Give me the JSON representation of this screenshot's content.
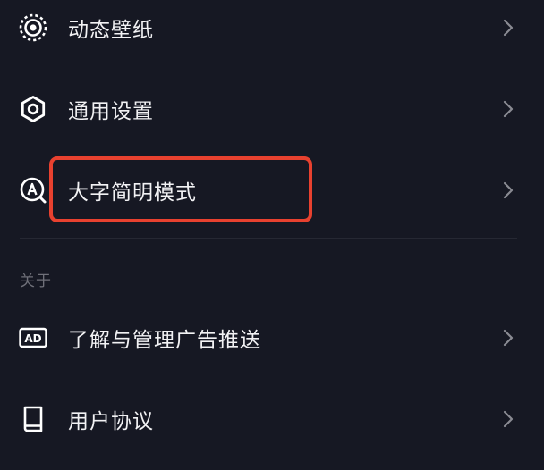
{
  "settings": {
    "items": [
      {
        "label": "动态壁纸",
        "icon": "live-wallpaper-icon"
      },
      {
        "label": "通用设置",
        "icon": "gear-icon"
      },
      {
        "label": "大字简明模式",
        "icon": "large-font-mode-icon"
      }
    ]
  },
  "about": {
    "header": "关于",
    "items": [
      {
        "label": "了解与管理广告推送",
        "icon": "ad-icon"
      },
      {
        "label": "用户协议",
        "icon": "book-icon"
      }
    ]
  },
  "highlight": {
    "color": "#e8412f",
    "target": "大字简明模式"
  },
  "colors": {
    "background": "#161823",
    "text": "#f2f2f4",
    "muted": "#6f7079",
    "chevron": "#8a8b93"
  }
}
